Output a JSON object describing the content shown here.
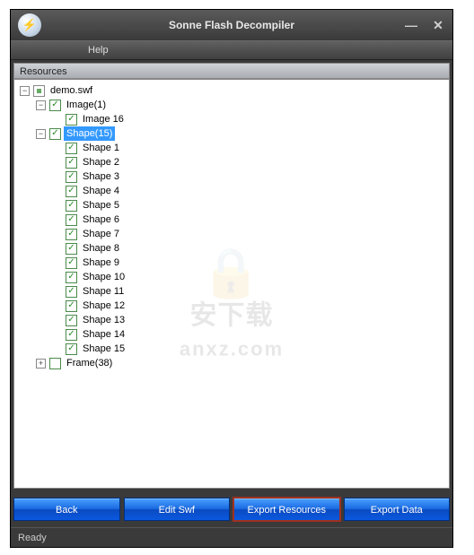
{
  "title": "Sonne Flash Decompiler",
  "menubar": {
    "help_label": "Help"
  },
  "panel": {
    "header": "Resources"
  },
  "tree": {
    "root": {
      "label": "demo.swf",
      "expanded": true,
      "icon": "square"
    },
    "image_group": {
      "label": "Image(1)",
      "expanded": true,
      "checked": true
    },
    "image_child": {
      "label": "Image 16",
      "checked": true
    },
    "shape_group": {
      "label": "Shape(15)",
      "expanded": true,
      "checked": true,
      "selected": true
    },
    "shapes": [
      {
        "label": "Shape 1"
      },
      {
        "label": "Shape 2"
      },
      {
        "label": "Shape 3"
      },
      {
        "label": "Shape 4"
      },
      {
        "label": "Shape 5"
      },
      {
        "label": "Shape 6"
      },
      {
        "label": "Shape 7"
      },
      {
        "label": "Shape 8"
      },
      {
        "label": "Shape 9"
      },
      {
        "label": "Shape 10"
      },
      {
        "label": "Shape 11"
      },
      {
        "label": "Shape 12"
      },
      {
        "label": "Shape 13"
      },
      {
        "label": "Shape 14"
      },
      {
        "label": "Shape 15"
      }
    ],
    "frame_group": {
      "label": "Frame(38)",
      "expanded": false,
      "checked": false
    }
  },
  "buttons": {
    "back": "Back",
    "edit_swf": "Edit Swf",
    "export_resources": "Export Resources",
    "export_data": "Export Data"
  },
  "status": "Ready",
  "watermark": {
    "line1": "安下载",
    "line2": "anxz.com"
  }
}
